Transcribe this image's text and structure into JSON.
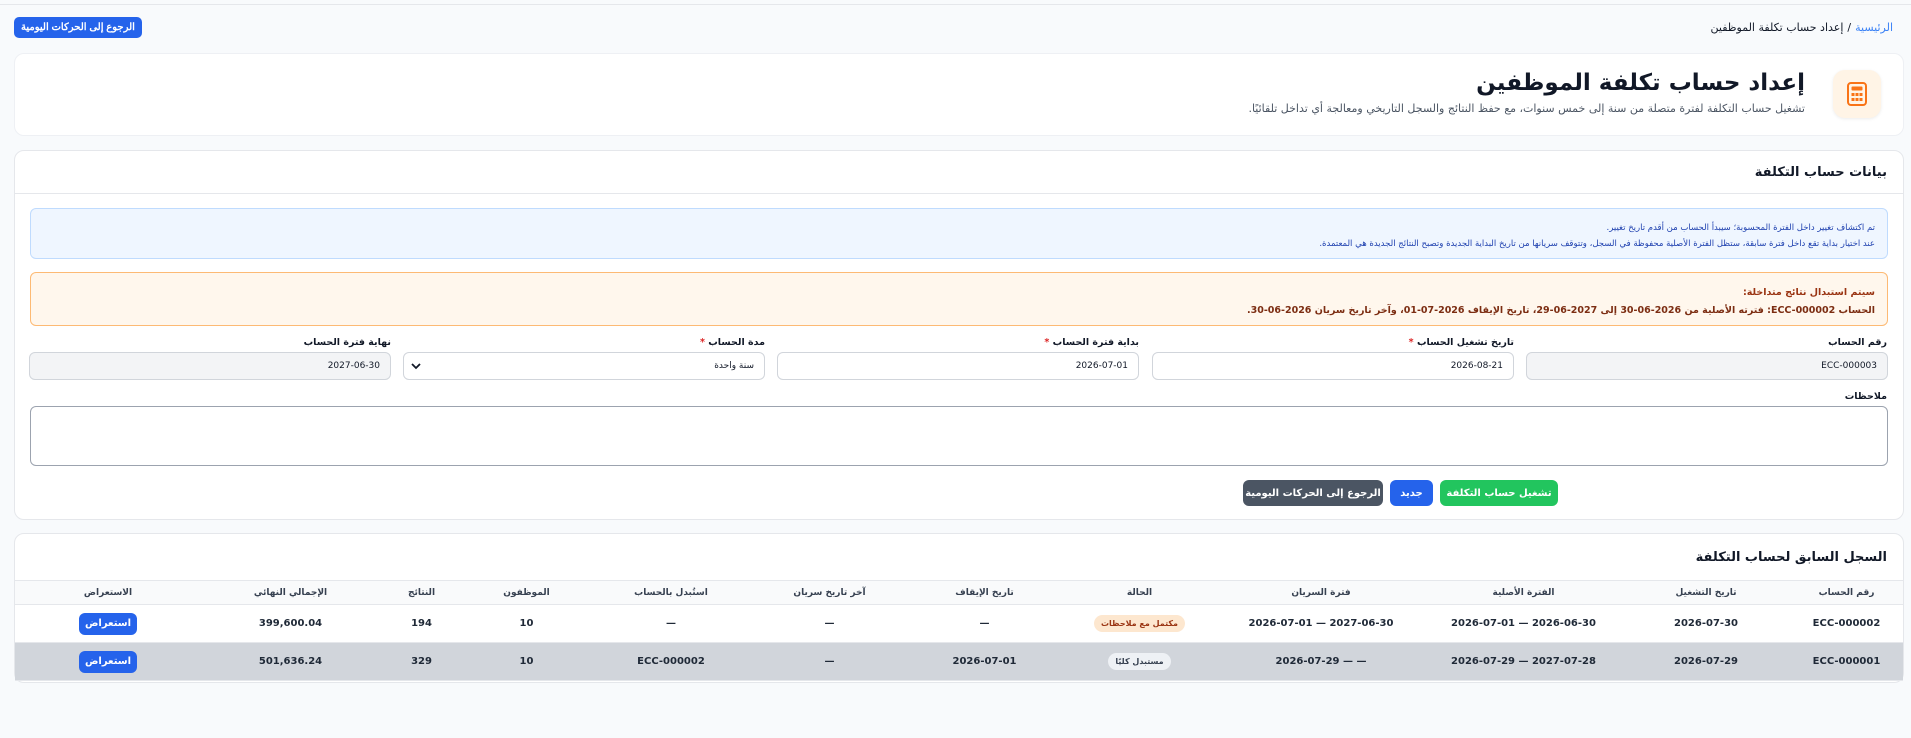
{
  "breadcrumb": {
    "home": "الرئيسية",
    "separator": "/",
    "current": "إعداد حساب تكلفة الموظفين"
  },
  "top_back_button": "الرجوع إلى الحركات اليومية",
  "hero": {
    "icon": "calculator-icon",
    "title": "إعداد حساب تكلفة الموظفين",
    "subtitle": "تشغيل حساب التكلفة لفترة متصلة من سنة إلى خمس سنوات، مع حفظ النتائج والسجل التاريخي ومعالجة أي تداخل تلقائيًا."
  },
  "form": {
    "title": "بيانات حساب التكلفة",
    "info_line1": "تم اكتشاف تغيير داخل الفترة المحسوبة؛ سيبدأ الحساب من أقدم تاريخ تغيير.",
    "info_line2": "عند اختيار بداية تقع داخل فترة سابقة، ستظل الفترة الأصلية محفوظة في السجل، وتتوقف سريانها من تاريخ البداية الجديدة وتصبح النتائج الجديدة هي المعتمدة.",
    "warn_line1": "سيتم استبدال نتائج متداخلة:",
    "warn_line2": "الحساب ECC-000002: فترته الأصلية من 2026-06-30 إلى 2027-06-29، تاريخ الإيقاف 2026-07-01، وآخر تاريخ سريان 2026-06-30.",
    "fields": {
      "account_number": {
        "label": "رقم الحساب",
        "value": "ECC-000003"
      },
      "run_date": {
        "label": "تاريخ تشغيل الحساب",
        "value": "2026-08-21"
      },
      "period_start": {
        "label": "بداية فترة الحساب",
        "value": "2026-07-01"
      },
      "duration": {
        "label": "مدة الحساب",
        "value": "سنة واحدة"
      },
      "period_end": {
        "label": "نهاية فترة الحساب",
        "value": "2027-06-30"
      }
    },
    "required_mark": "*",
    "notes_label": "ملاحظات",
    "notes_value": "",
    "buttons": {
      "run": "تشغيل حساب التكلفة",
      "new": "جديد",
      "back": "الرجوع إلى الحركات اليومية"
    }
  },
  "history": {
    "title": "السجل السابق لحساب التكلفة",
    "columns": [
      "رقم الحساب",
      "تاريخ التشغيل",
      "الفترة الأصلية",
      "فترة السريان",
      "الحالة",
      "تاريخ الإيقاف",
      "آخر تاريخ سريان",
      "استُبدل بالحساب",
      "الموظفون",
      "النتائج",
      "الإجمالي النهائي",
      "الاستعراض"
    ],
    "rows": [
      [
        "ECC-000002",
        "2026-07-30",
        "2026-07-01 — 2026-06-30",
        "2026-07-01 — 2027-06-30",
        "مكتمل مع ملاحظات",
        "—",
        "—",
        "—",
        "10",
        "194",
        "399,600.04",
        "استعراض"
      ],
      [
        "ECC-000001",
        "2026-07-29",
        "2026-07-29 — 2027-07-28",
        "2026-07-29 — —",
        "مستبدل كليًا",
        "2026-07-01",
        "—",
        "ECC-000002",
        "10",
        "329",
        "501,636.24",
        "استعراض"
      ]
    ]
  },
  "colors": {
    "primary": "#2563eb",
    "success": "#22c55e",
    "secondary": "#4b5563",
    "warn_bg": "#fff7ed",
    "info_bg": "#eff6ff"
  }
}
